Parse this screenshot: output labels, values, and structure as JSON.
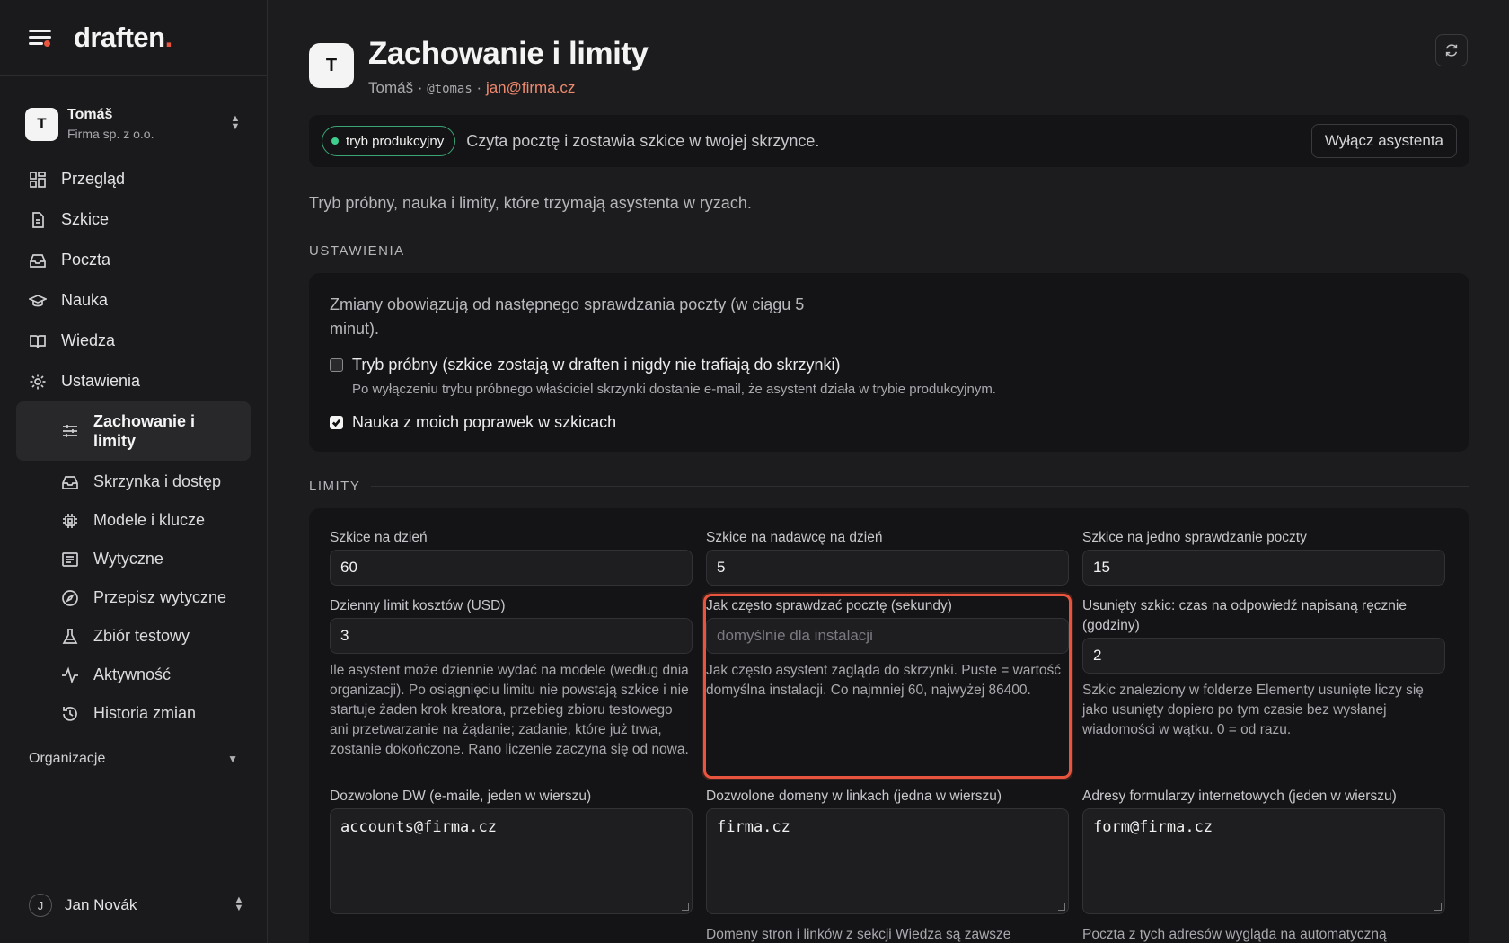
{
  "brand": {
    "name": "draften",
    "dot": "."
  },
  "account": {
    "initial": "T",
    "name": "Tomáš",
    "org": "Firma sp. z o.o."
  },
  "nav": {
    "items": [
      {
        "label": "Przegląd",
        "icon": "dashboard-icon"
      },
      {
        "label": "Szkice",
        "icon": "document-icon"
      },
      {
        "label": "Poczta",
        "icon": "inbox-icon"
      },
      {
        "label": "Nauka",
        "icon": "graduation-cap-icon"
      },
      {
        "label": "Wiedza",
        "icon": "book-icon"
      },
      {
        "label": "Ustawienia",
        "icon": "gear-icon"
      }
    ],
    "sub_items": [
      {
        "label": "Zachowanie i limity",
        "icon": "sliders-icon",
        "active": true
      },
      {
        "label": "Skrzynka i dostęp",
        "icon": "inbox-icon"
      },
      {
        "label": "Modele i klucze",
        "icon": "chip-icon"
      },
      {
        "label": "Wytyczne",
        "icon": "list-icon"
      },
      {
        "label": "Przepisz wytyczne",
        "icon": "compass-icon"
      },
      {
        "label": "Zbiór testowy",
        "icon": "flask-icon"
      },
      {
        "label": "Aktywność",
        "icon": "activity-icon"
      },
      {
        "label": "Historia zmian",
        "icon": "history-icon"
      }
    ],
    "org_section": "Organizacje"
  },
  "user": {
    "initial": "J",
    "name": "Jan Novák"
  },
  "header": {
    "initial": "T",
    "title": "Zachowanie i limity",
    "name": "Tomáš",
    "sep": "·",
    "handle": "@tomas",
    "email": "jan@firma.cz"
  },
  "status": {
    "pill": "tryb produkcyjny",
    "text": "Czyta pocztę i zostawia szkice w twojej skrzynce.",
    "button": "Wyłącz asystenta"
  },
  "lead": "Tryb próbny, nauka i limity, które trzymają asystenta w ryzach.",
  "settings": {
    "heading": "USTAWIENIA",
    "note": "Zmiany obowiązują od następnego sprawdzania poczty (w ciągu 5 minut).",
    "trial": {
      "checked": false,
      "label": "Tryb próbny (szkice zostają w draften i nigdy nie trafiają do skrzynki)",
      "help": "Po wyłączeniu trybu próbnego właściciel skrzynki dostanie e-mail, że asystent działa w trybie produkcyjnym."
    },
    "learn": {
      "checked": true,
      "label": "Nauka z moich poprawek w szkicach"
    }
  },
  "limits": {
    "heading": "LIMITY",
    "drafts_per_day": {
      "label": "Szkice na dzień",
      "value": "60"
    },
    "drafts_per_sender": {
      "label": "Szkice na nadawcę na dzień",
      "value": "5"
    },
    "drafts_per_check": {
      "label": "Szkice na jedno sprawdzanie poczty",
      "value": "15"
    },
    "cost_limit": {
      "label": "Dzienny limit kosztów (USD)",
      "value": "3",
      "help": "Ile asystent może dziennie wydać na modele (według dnia organizacji). Po osiągnięciu limitu nie powstają szkice i nie startuje żaden krok kreatora, przebieg zbioru testowego ani przetwarzanie na żądanie; zadanie, które już trwa, zostanie dokończone. Rano liczenie zaczyna się od nowa."
    },
    "poll_interval": {
      "label": "Jak często sprawdzać pocztę (sekundy)",
      "placeholder": "domyślnie dla instalacji",
      "help": "Jak często asystent zagląda do skrzynki. Puste = wartość domyślna instalacji. Co najmniej 60, najwyżej 86400."
    },
    "deleted_draft": {
      "label": "Usunięty szkic: czas na odpowiedź napisaną ręcznie (godziny)",
      "value": "2",
      "help": "Szkic znaleziony w folderze Elementy usunięte liczy się jako usunięty dopiero po tym czasie bez wysłanej wiadomości w wątku. 0 = od razu."
    },
    "allowed_cc": {
      "label": "Dozwolone DW (e-maile, jeden w wierszu)",
      "value": "accounts@firma.cz"
    },
    "allowed_domains": {
      "label": "Dozwolone domeny w linkach (jedna w wierszu)",
      "value": "firma.cz",
      "help": "Domeny stron i linków z sekcji Wiedza są zawsze"
    },
    "form_addresses": {
      "label": "Adresy formularzy internetowych (jeden w wierszu)",
      "value": "form@firma.cz",
      "help": "Poczta z tych adresów wygląda na automatyczną"
    }
  },
  "colors": {
    "accent": "#e8553e",
    "success": "#3ecf8e",
    "link": "#f08a6e"
  }
}
